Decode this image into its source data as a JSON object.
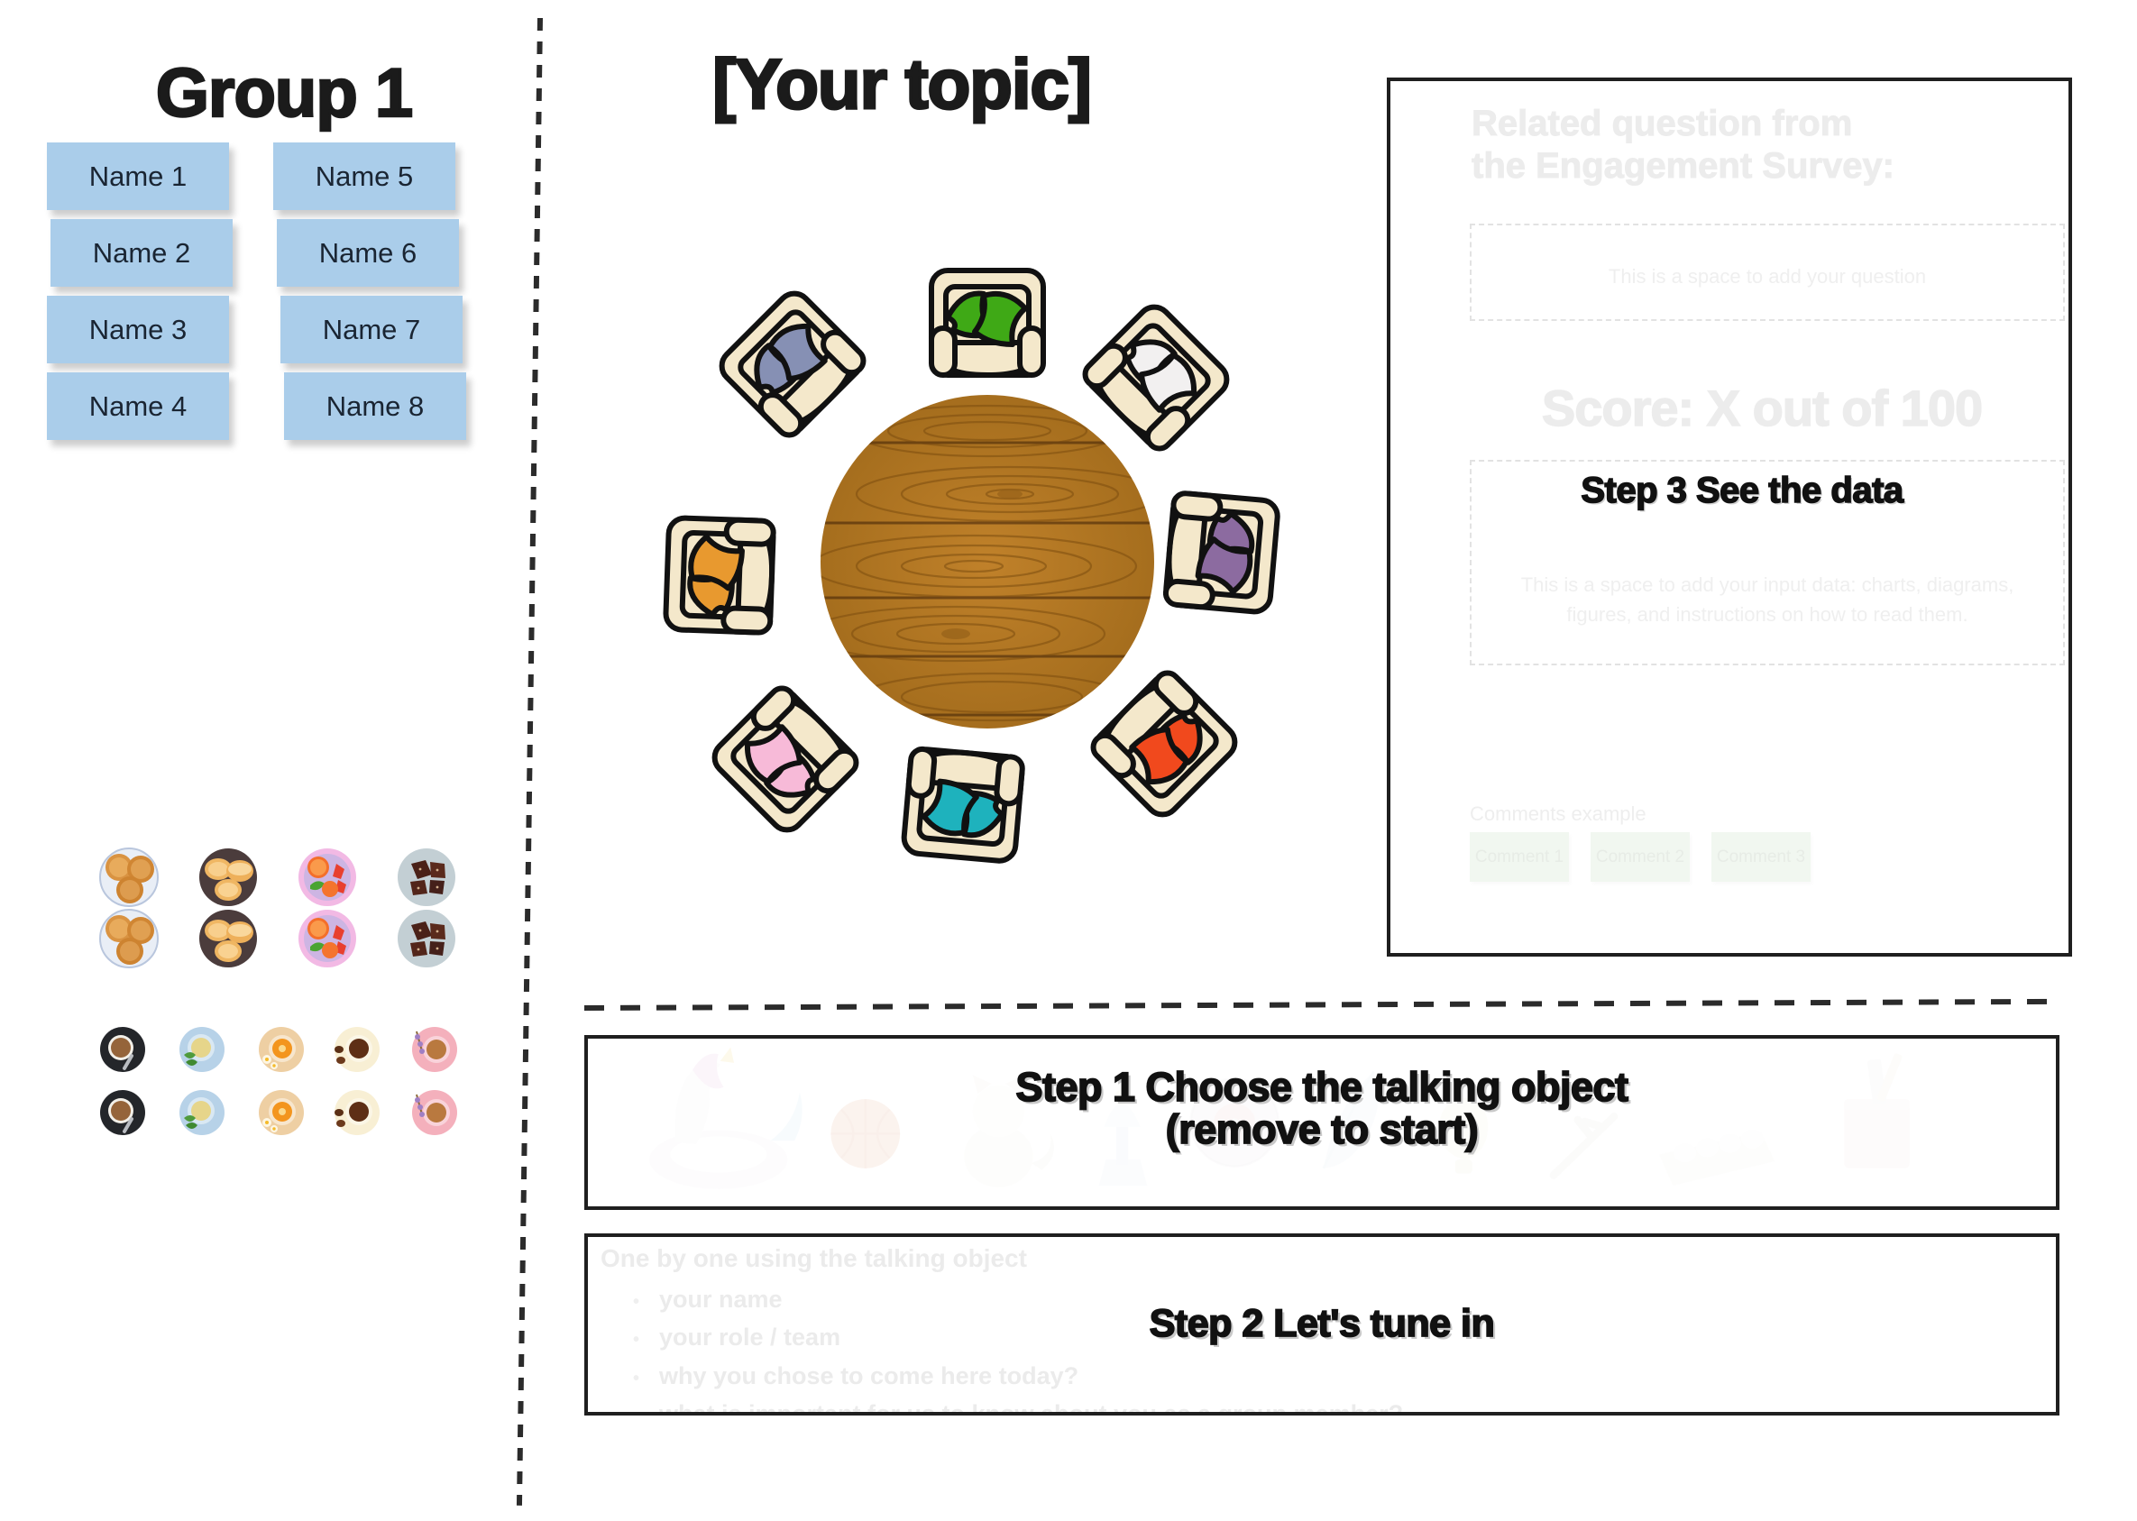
{
  "left_panel": {
    "group_title": "Group 1",
    "name_notes": [
      {
        "label": "Name 1"
      },
      {
        "label": "Name 2"
      },
      {
        "label": "Name 3"
      },
      {
        "label": "Name 4"
      },
      {
        "label": "Name 5"
      },
      {
        "label": "Name 6"
      },
      {
        "label": "Name 7"
      },
      {
        "label": "Name 8"
      }
    ],
    "refreshments": {
      "plates": [
        "muffins-plate",
        "pastries-plate",
        "fruit-plate",
        "brownies-plate"
      ],
      "cups": [
        "black-coffee-cup",
        "mint-tea-cup",
        "chamomile-tea-cup",
        "coffee-beans-cup",
        "floral-tea-cup"
      ],
      "plate_rows": 2,
      "cup_rows": 2
    }
  },
  "center": {
    "topic_title": "[Your topic]",
    "table": {
      "shape": "round",
      "material": "wood",
      "seat_count": 8,
      "seats": [
        {
          "position": "top",
          "cushion_color": "#3fa916"
        },
        {
          "position": "top-right",
          "cushion_color": "#f2f0f0"
        },
        {
          "position": "right",
          "cushion_color": "#8c6ba0"
        },
        {
          "position": "bottom-right",
          "cushion_color": "#f1491d"
        },
        {
          "position": "bottom",
          "cushion_color": "#1eb2bd"
        },
        {
          "position": "bottom-left",
          "cushion_color": "#f7bad8"
        },
        {
          "position": "left",
          "cushion_color": "#e8992f"
        },
        {
          "position": "top-left",
          "cushion_color": "#8690b4"
        }
      ],
      "chair_body_color": "#f4e8cb",
      "table_color": "#b5771f"
    }
  },
  "survey_panel": {
    "heading": "Related question from\nthe Engagement Survey:",
    "question_placeholder": "This is a space to add your question",
    "score_line": "Score: X out of 100",
    "step3_label": "Step 3 See the data",
    "data_placeholder": "This is a space to add your input data: charts, diagrams, figures, and instructions on how to read them.",
    "comments_label": "Comments example",
    "comments": [
      "Comment 1",
      "Comment 2",
      "Comment 3"
    ]
  },
  "step1": {
    "title_line1": "Step 1 Choose the talking object",
    "title_line2": "(remove to start)",
    "background_objects": [
      "unicorn-float",
      "basketball",
      "cat-figurine",
      "lamp",
      "record",
      "feather",
      "bulb",
      "branch",
      "egg-carton",
      "pencil-cup"
    ]
  },
  "step2": {
    "title": "Step 2 Let's tune in",
    "intro": "One by one using the talking object",
    "bullets": [
      "your name",
      "your role / team",
      "why you chose to come here today?",
      "what is important for us to know about you as a group member?"
    ]
  },
  "colors": {
    "sticky_blue": "#aacdea",
    "ink": "#1b1b1b",
    "faint_gray": "#ececec",
    "comment_green": "#f1f7f0",
    "wood": "#b5771f",
    "chair": "#f4e8cb"
  }
}
